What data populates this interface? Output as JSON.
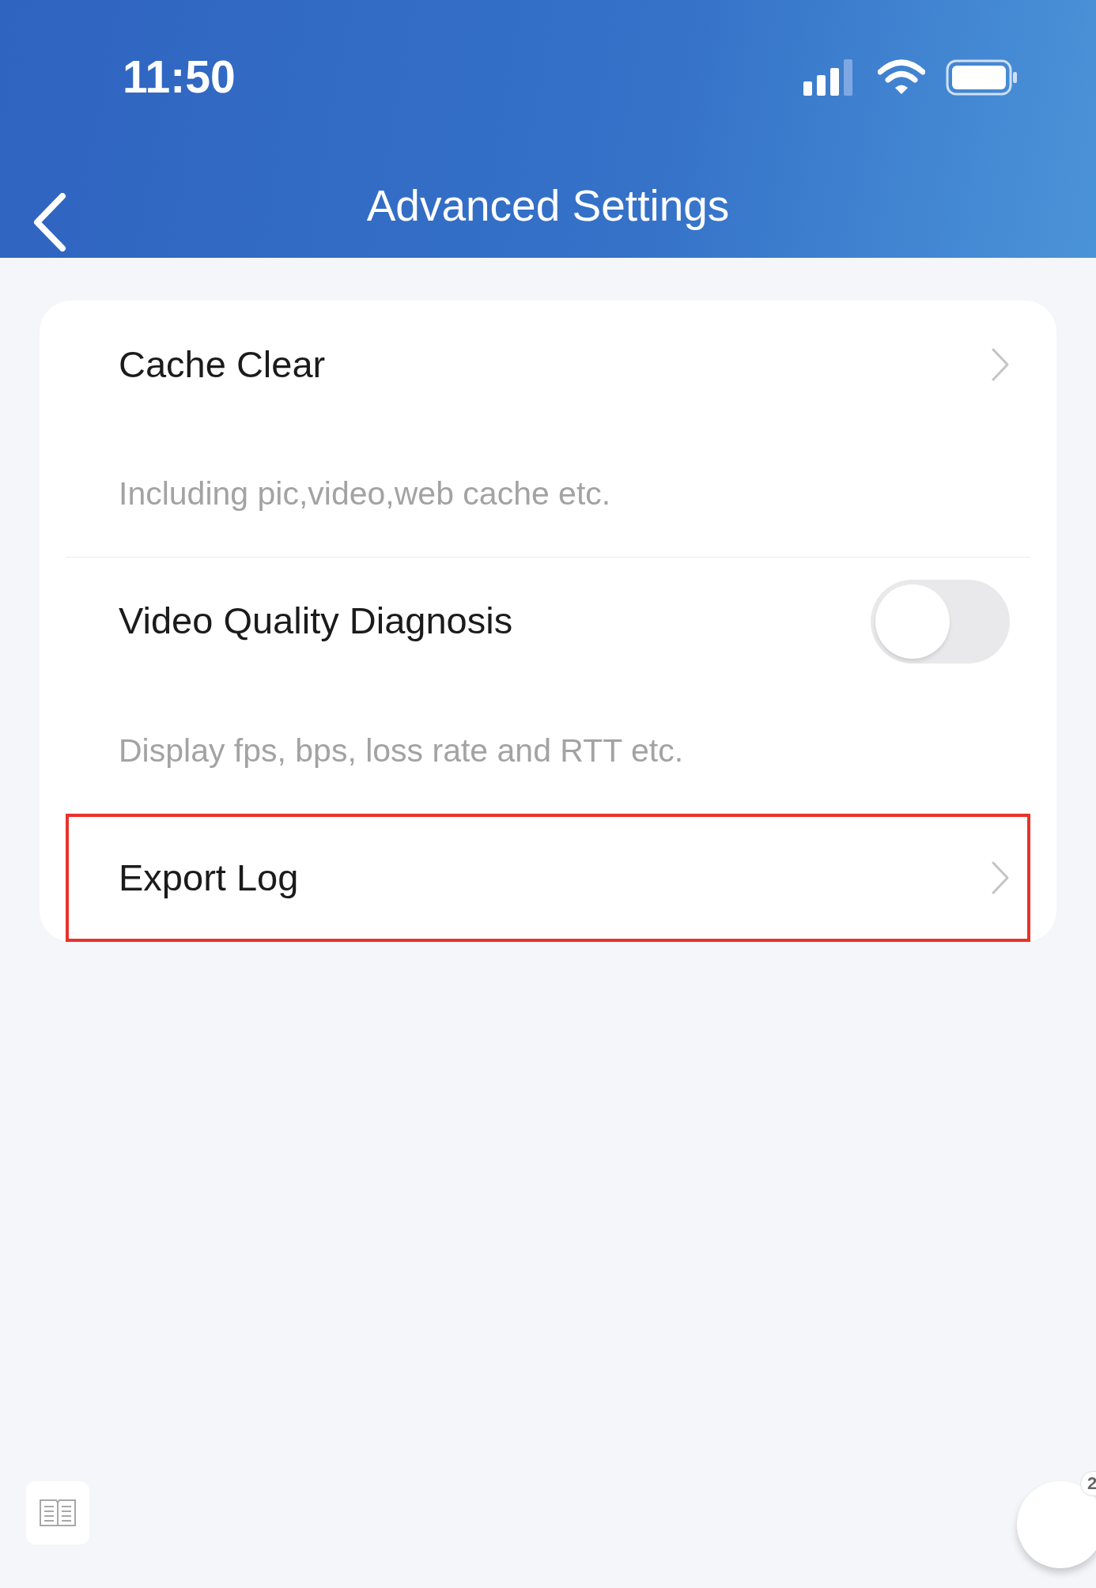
{
  "status_bar": {
    "time": "11:50"
  },
  "header": {
    "title": "Advanced Settings"
  },
  "settings": [
    {
      "kind": "link",
      "label": "Cache Clear",
      "description": "Including pic,video,web cache etc.",
      "highlighted": false
    },
    {
      "kind": "toggle",
      "label": "Video Quality Diagnosis",
      "description": "Display fps, bps, loss rate and RTT etc.",
      "on": false,
      "highlighted": false
    },
    {
      "kind": "link",
      "label": "Export Log",
      "highlighted": true
    }
  ],
  "floating_button": {
    "badge": "2"
  }
}
